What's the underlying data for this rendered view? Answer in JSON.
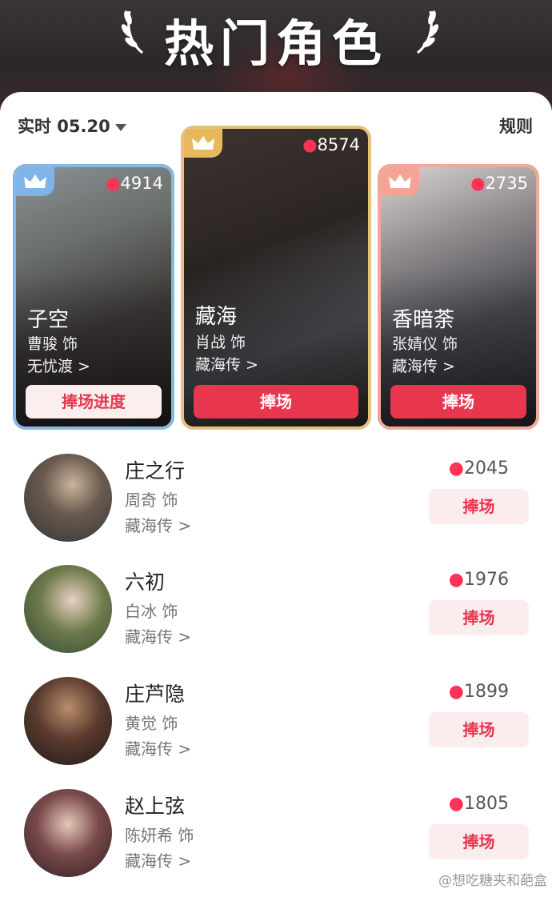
{
  "header": {
    "title": "热门角色"
  },
  "controls": {
    "date_label": "实时 05.20",
    "rule_label": "规则"
  },
  "top_cards": [
    {
      "rank_color": "#7fb4e6",
      "heat": "4914",
      "role": "子空",
      "actor": "曹骏 饰",
      "drama": "无忧渡 >",
      "button": "捧场进度"
    },
    {
      "rank_color": "#e8b85c",
      "heat": "8574",
      "role": "藏海",
      "actor": "肖战 饰",
      "drama": "藏海传 >",
      "button": "捧场"
    },
    {
      "rank_color": "#f3a494",
      "heat": "2735",
      "role": "香暗荼",
      "actor": "张婧仪 饰",
      "drama": "藏海传 >",
      "button": "捧场"
    }
  ],
  "list": [
    {
      "role": "庄之行",
      "actor": "周奇 饰",
      "drama": "藏海传 >",
      "heat": "2045",
      "button": "捧场"
    },
    {
      "role": "六初",
      "actor": "白冰 饰",
      "drama": "藏海传 >",
      "heat": "1976",
      "button": "捧场"
    },
    {
      "role": "庄芦隐",
      "actor": "黄觉 饰",
      "drama": "藏海传 >",
      "heat": "1899",
      "button": "捧场"
    },
    {
      "role": "赵上弦",
      "actor": "陈妍希 饰",
      "drama": "藏海传 >",
      "heat": "1805",
      "button": "捧场"
    }
  ],
  "watermark": "@想吃糖夹和葩盒",
  "colors": {
    "accent": "#e8364f",
    "button_soft": "#fdecee",
    "flame": "#ff3355"
  }
}
